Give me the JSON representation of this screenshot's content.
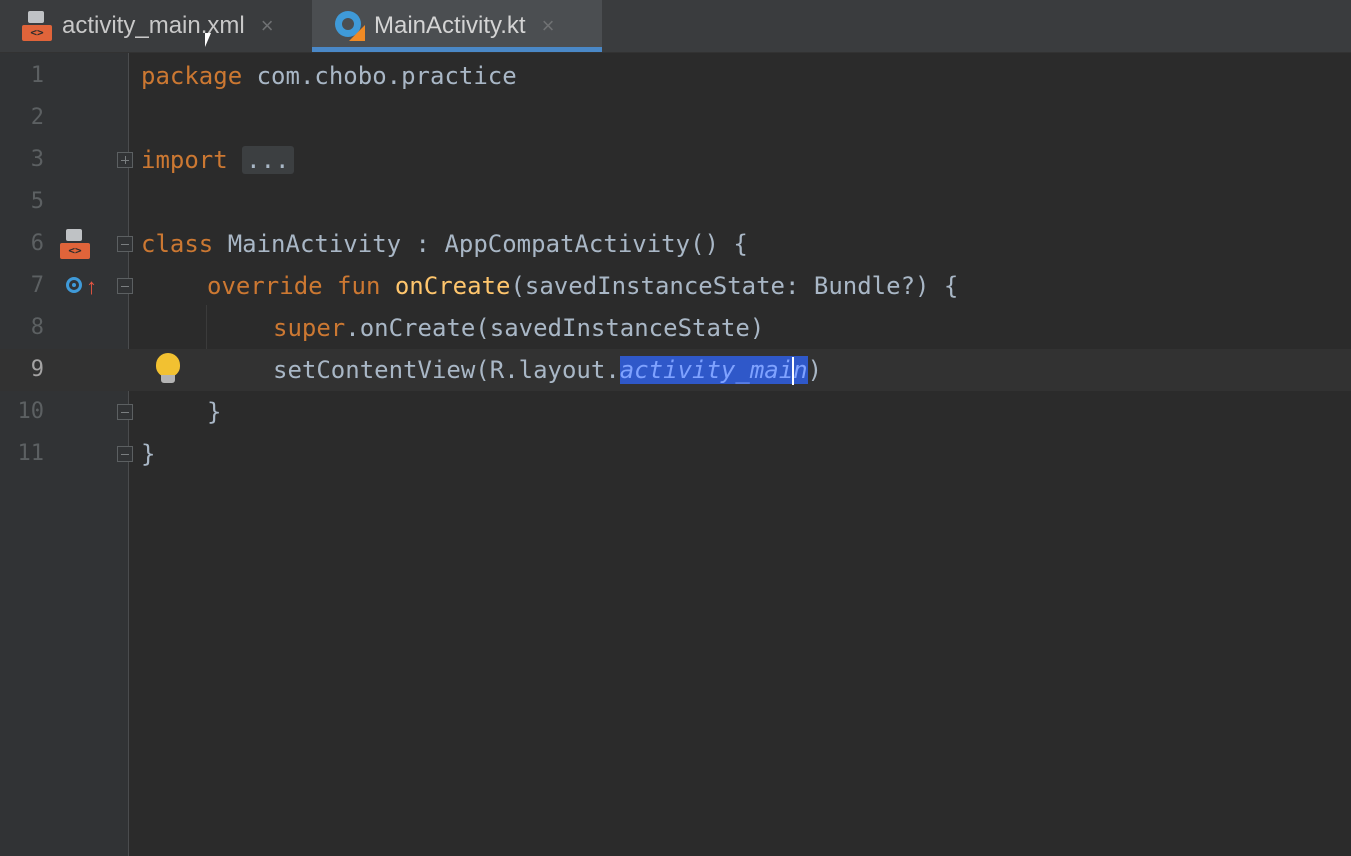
{
  "tabs": [
    {
      "label": "activity_main.xml",
      "icon": "xml-file-icon",
      "active": false
    },
    {
      "label": "MainActivity.kt",
      "icon": "kotlin-file-icon",
      "active": true
    }
  ],
  "tab_close_glyph": "×",
  "xml_icon_text": "<>",
  "editor": {
    "lines": [
      {
        "number": "1",
        "pre": "package",
        "rest": " com.chobo.practice"
      },
      {
        "number": "2"
      },
      {
        "number": "3",
        "pre": "import",
        "fold": "..."
      },
      {
        "number": "5"
      },
      {
        "number": "6",
        "kw": "class",
        "rest": " MainActivity : AppCompatActivity() {"
      },
      {
        "number": "7",
        "kw1": "override",
        "kw2": "fun",
        "fn": "onCreate",
        "rest": "(savedInstanceState: Bundle?) {"
      },
      {
        "number": "8",
        "kw": "super",
        "rest": ".onCreate(savedInstanceState)"
      },
      {
        "number": "9",
        "pre": "setContentView(R.layout.",
        "sel1": "activity_mai",
        "sel2": "n",
        "post": ")"
      },
      {
        "number": "10",
        "rest": "}"
      },
      {
        "number": "11",
        "rest": "}"
      }
    ],
    "current_line": "9"
  },
  "colors": {
    "background": "#2b2b2b",
    "keyword": "#cc7832",
    "function": "#ffc66d",
    "text": "#a9b7c6",
    "selection": "#2f58c9",
    "tab_accent": "#4a88c7"
  }
}
